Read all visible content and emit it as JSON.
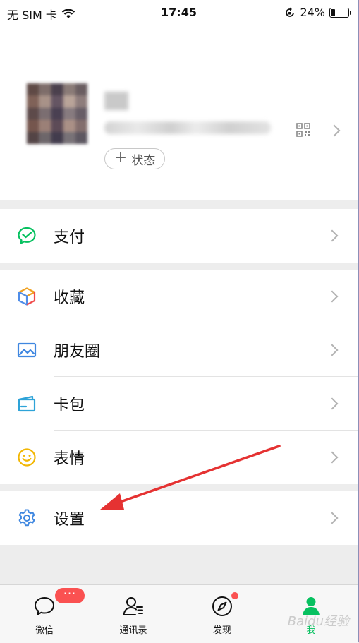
{
  "status_bar": {
    "carrier": "无 SIM 卡",
    "time": "17:45",
    "battery": "24%",
    "battery_level": 0.24
  },
  "profile": {
    "status_label": "状态",
    "status_plus": "+"
  },
  "menu": {
    "pay": "支付",
    "favorites": "收藏",
    "moments": "朋友圈",
    "cards": "卡包",
    "stickers": "表情",
    "settings": "设置"
  },
  "tabs": [
    {
      "label": "微信",
      "icon": "chat-bubble-icon",
      "badge": "···"
    },
    {
      "label": "通讯录",
      "icon": "contacts-icon"
    },
    {
      "label": "发现",
      "icon": "compass-icon"
    },
    {
      "label": "我",
      "icon": "me-icon",
      "active": true
    }
  ],
  "colors": {
    "accent_green": "#07c160",
    "badge_red": "#fa5151",
    "annotation_arrow": "#e53232"
  },
  "watermark": "Baidu经验"
}
